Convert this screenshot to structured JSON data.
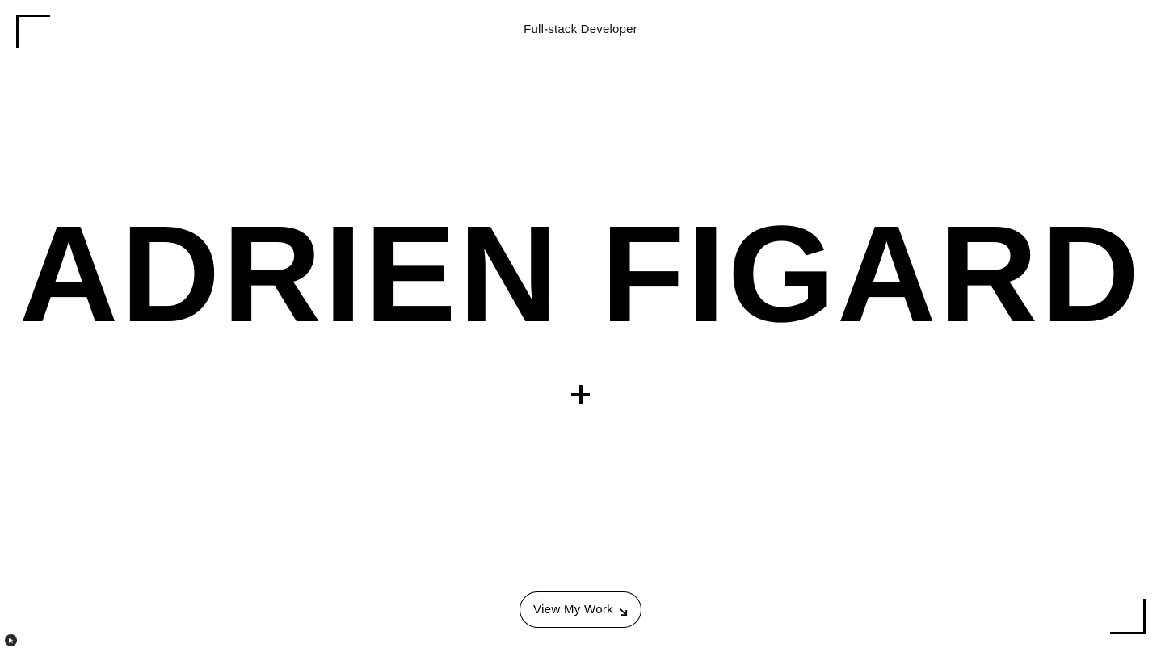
{
  "header": {
    "subtitle": "Full-stack Developer"
  },
  "hero": {
    "title": "ADRIEN FIGARD",
    "divider_icon": "plus-icon"
  },
  "cta": {
    "label": "View My Work",
    "icon": "arrow-down-right-icon"
  },
  "decor": {
    "top_left": "corner-bracket-icon",
    "bottom_right": "corner-bracket-icon",
    "badge_icon": "cursor-icon"
  },
  "colors": {
    "background": "#ffffff",
    "foreground": "#000000"
  }
}
